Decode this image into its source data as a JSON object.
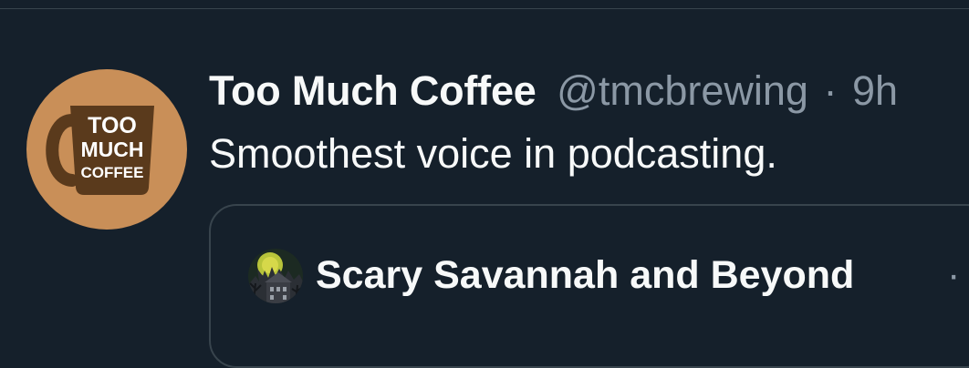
{
  "tweet": {
    "author": {
      "name": "Too Much Coffee",
      "handle": "@tmcbrewing",
      "timestamp": "9h",
      "separator": "·",
      "avatar": {
        "icon": "coffee-mug-logo",
        "logo_text": [
          "TOO",
          "MUCH",
          "COFFEE"
        ],
        "background": "#c98f58",
        "mug_color": "#5a3a1c"
      }
    },
    "text": "Smoothest voice in podcasting.",
    "quoted": {
      "name": "Scary Savannah and Beyond",
      "separator": "·",
      "avatar": {
        "icon": "haunted-house-icon"
      }
    }
  },
  "colors": {
    "background": "#15202b",
    "primary_text": "#f7f9f9",
    "secondary_text": "#8b98a5",
    "border": "#38444d"
  }
}
